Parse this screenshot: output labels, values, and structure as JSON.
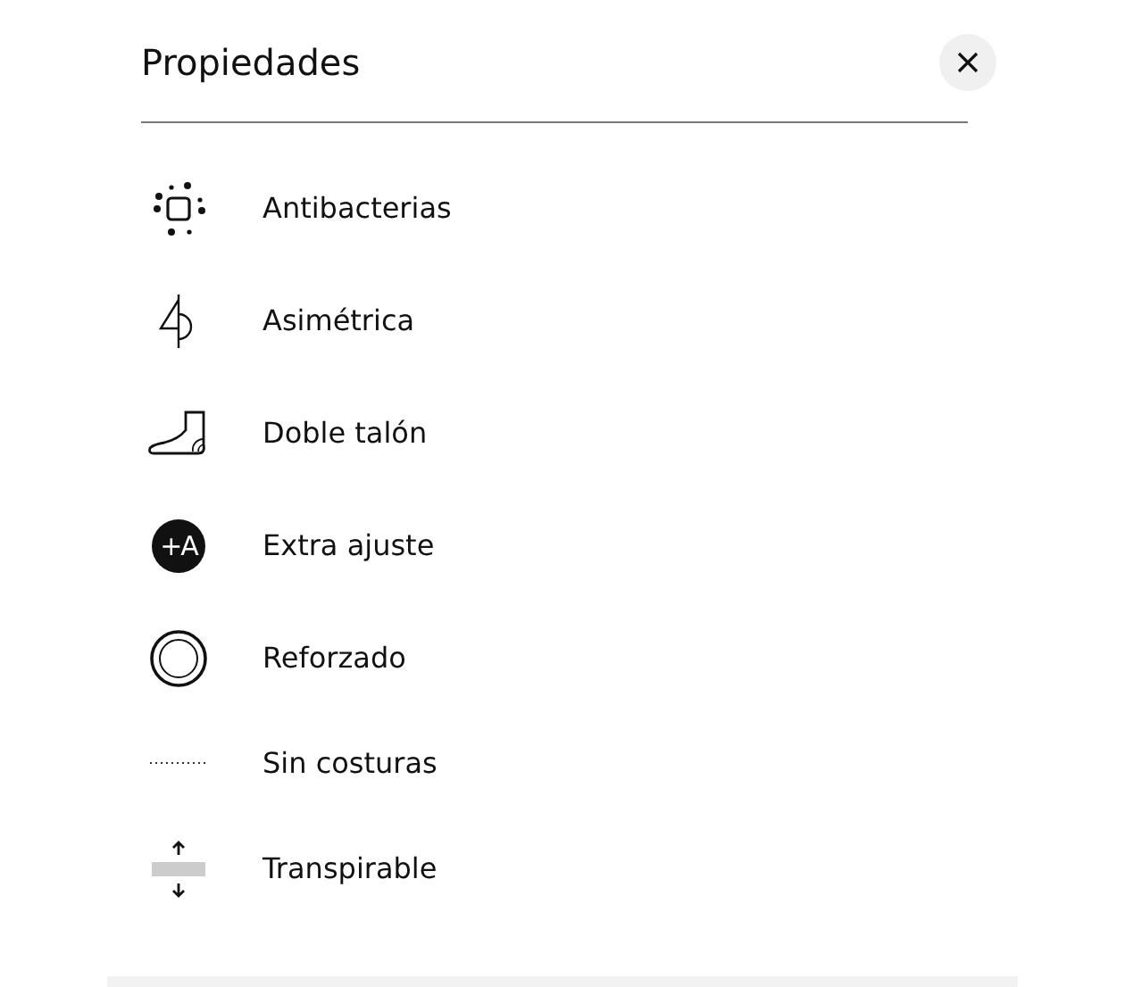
{
  "title": "Propiedades",
  "properties": [
    {
      "kind": "antibacterial",
      "label": "Antibacterias"
    },
    {
      "kind": "asymmetric",
      "label": "Asimétrica"
    },
    {
      "kind": "heel",
      "label": "Doble talón"
    },
    {
      "kind": "badge",
      "badge": "+A",
      "label": "Extra ajuste"
    },
    {
      "kind": "rings",
      "label": "Reforzado"
    },
    {
      "kind": "dots",
      "label": "Sin costuras"
    },
    {
      "kind": "breathable",
      "label": "Transpirable"
    }
  ]
}
